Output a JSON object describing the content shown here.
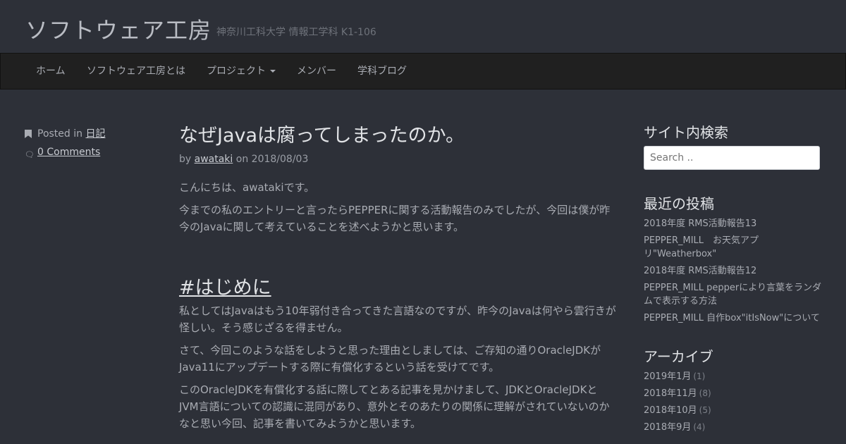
{
  "site": {
    "title": "ソフトウェア工房",
    "description": "神奈川工科大学 情報工学科 K1-106"
  },
  "nav": {
    "items": [
      "ホーム",
      "ソフトウェア工房とは",
      "プロジェクト",
      "メンバー",
      "学科ブログ"
    ]
  },
  "post_meta": {
    "posted_in_label": "Posted in",
    "category": "日記",
    "comments": "0 Comments"
  },
  "article": {
    "title": "なぜJavaは腐ってしまったのか。",
    "by_label": "by",
    "author": "awataki",
    "on_label": "on",
    "date": "2018/08/03",
    "intro": [
      "こんにちは、awatakiです。",
      "今までの私のエントリーと言ったらPEPPERに関する活動報告のみでしたが、今回は僕が昨今のJavaに関して考えていることを述べようかと思います。"
    ],
    "section_heading": "#はじめに",
    "section_paragraphs": [
      "私としてはJavaはもう10年弱付き合ってきた言語なのですが、昨今のJavaは何やら雲行きが怪しい。そう感じざるを得ません。",
      "さて、今回このような話をしようと思った理由としましては、ご存知の通りOracleJDKがJava11にアップデートする際に有償化するという話を受けてです。",
      "このOracleJDKを有償化する話に際してとある記事を見かけまして、JDKとOracleJDKとJVM言語についての認識に混同があり、意外とそのあたりの関係に理解がされていないのかなと思い今回、記事を書いてみようかと思います。"
    ]
  },
  "sidebar": {
    "search_title": "サイト内検索",
    "search_placeholder": "Search ..",
    "recent_title": "最近の投稿",
    "recent_posts": [
      "2018年度 RMS活動報告13",
      "PEPPER_MILL　お天気アプリ\"Weatherbox\"",
      "2018年度 RMS活動報告12",
      "PEPPER_MILL pepperにより言葉をランダムで表示する方法",
      "PEPPER_MILL 自作box\"itIsNow\"について"
    ],
    "archive_title": "アーカイブ",
    "archives": [
      {
        "label": "2019年1月",
        "count": "(1)"
      },
      {
        "label": "2018年11月",
        "count": "(8)"
      },
      {
        "label": "2018年10月",
        "count": "(5)"
      },
      {
        "label": "2018年9月",
        "count": "(4)"
      }
    ]
  },
  "colors": {
    "background": "#2d3038",
    "navbar": "#202020",
    "heading": "#e1e3e6",
    "text": "#a9acb3"
  },
  "icons": {
    "category": "bookmark-icon",
    "comments": "comments-icon",
    "dropdown": "caret-down-icon"
  }
}
